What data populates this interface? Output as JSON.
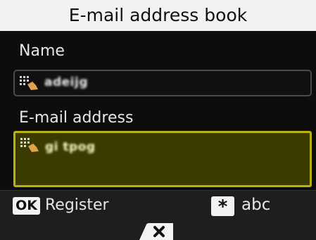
{
  "screen": {
    "title": "E-mail address book",
    "name_label": "Name",
    "email_label": "E-mail address",
    "name_value": "adeijg",
    "email_value": "gi tpog"
  },
  "footer": {
    "ok_key": "OK",
    "ok_action": "Register",
    "star_key": "*",
    "star_action": "abc"
  },
  "colors": {
    "selected_field_border": "#b9b20c",
    "selected_field_bg": "#3b3a00"
  },
  "icons": {
    "input_mode": "keypad-hand-icon",
    "backspace": "backspace-icon"
  }
}
